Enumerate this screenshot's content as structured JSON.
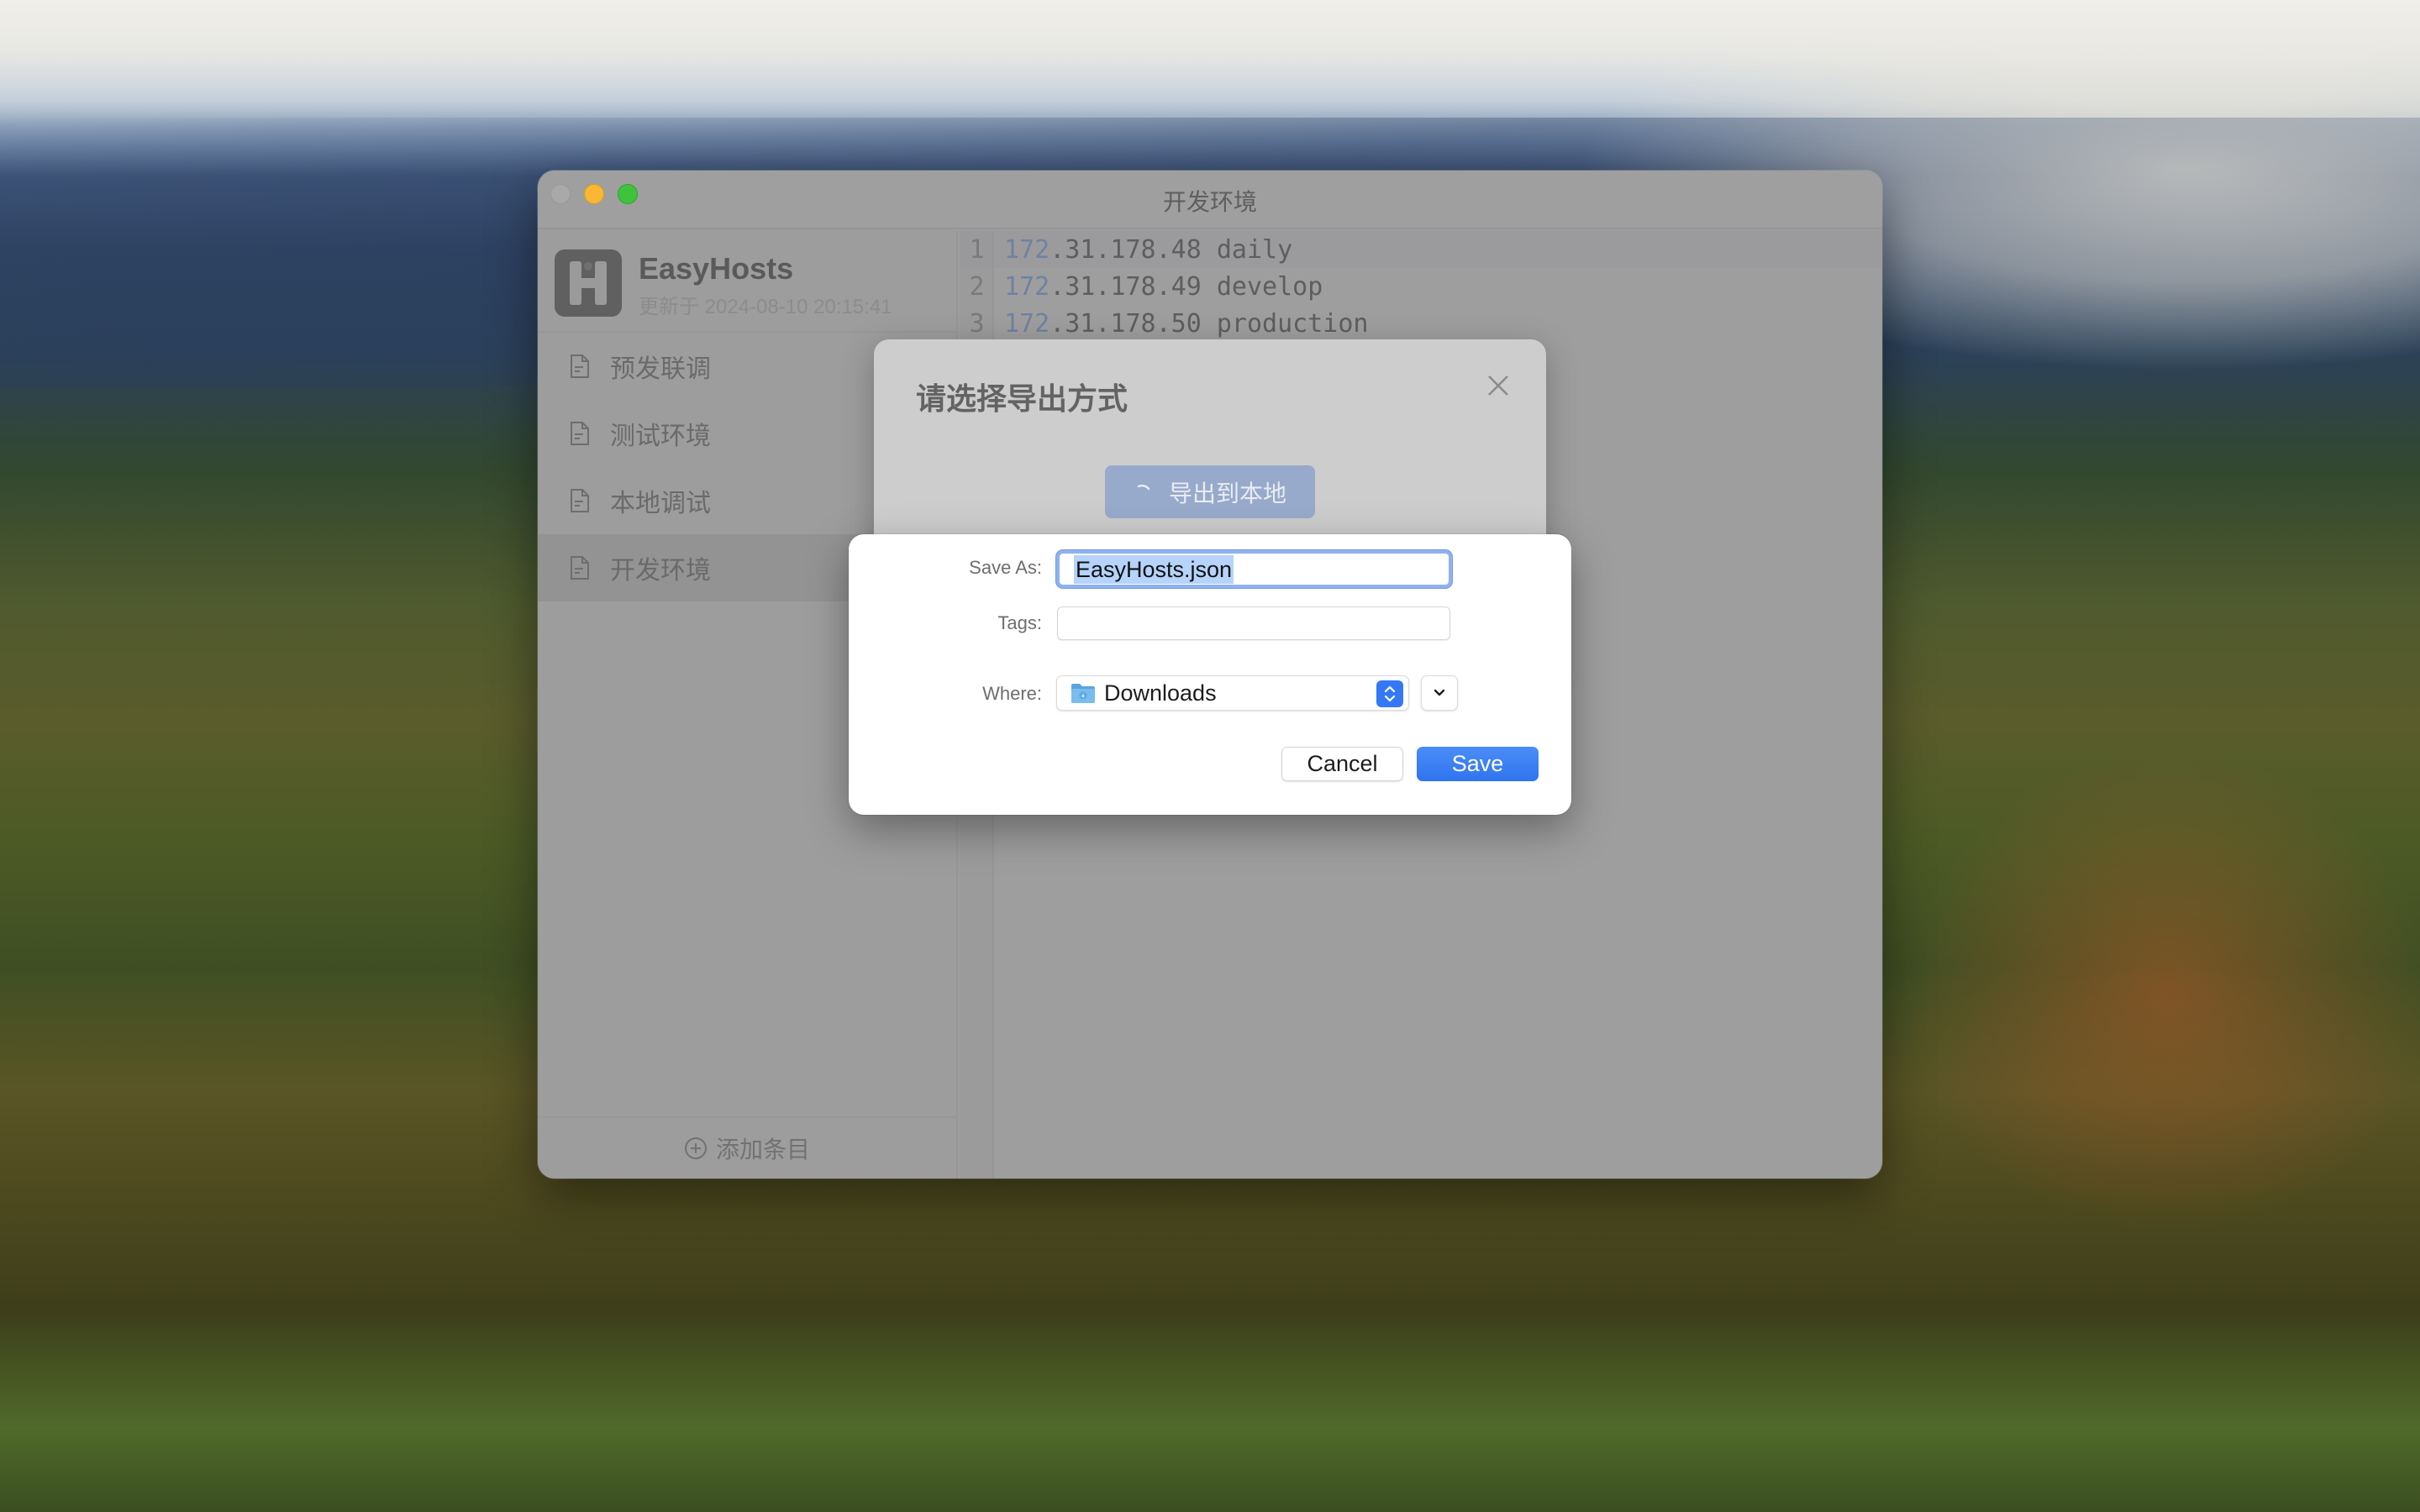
{
  "window": {
    "title": "开发环境"
  },
  "app": {
    "name": "EasyHosts",
    "updated": "更新于 2024-08-10 20:15:41",
    "logo_letter": "H"
  },
  "sidebar": {
    "items": [
      {
        "label": "预发联调",
        "icon": "file-icon",
        "active": false
      },
      {
        "label": "测试环境",
        "icon": "file-icon",
        "active": false
      },
      {
        "label": "本地调试",
        "icon": "file-icon",
        "active": false
      },
      {
        "label": "开发环境",
        "icon": "file-icon",
        "active": true
      }
    ],
    "add_label": "添加条目",
    "add_icon": "plus-circle-icon"
  },
  "editor": {
    "lines": [
      {
        "n": "1",
        "num": "172",
        "rest": ".31.178.48 daily"
      },
      {
        "n": "2",
        "num": "172",
        "rest": ".31.178.49 develop"
      },
      {
        "n": "3",
        "num": "172",
        "rest": ".31.178.50 production"
      }
    ]
  },
  "export_modal": {
    "title": "请选择导出方式",
    "button_label": "导出到本地",
    "button_state": "loading",
    "close_icon": "close-icon"
  },
  "save_sheet": {
    "save_as_label": "Save As:",
    "save_as_value": "EasyHosts.json",
    "tags_label": "Tags:",
    "tags_value": "",
    "where_label": "Where:",
    "where_value": "Downloads",
    "cancel_label": "Cancel",
    "save_label": "Save",
    "accent_color": "#3478f6"
  }
}
